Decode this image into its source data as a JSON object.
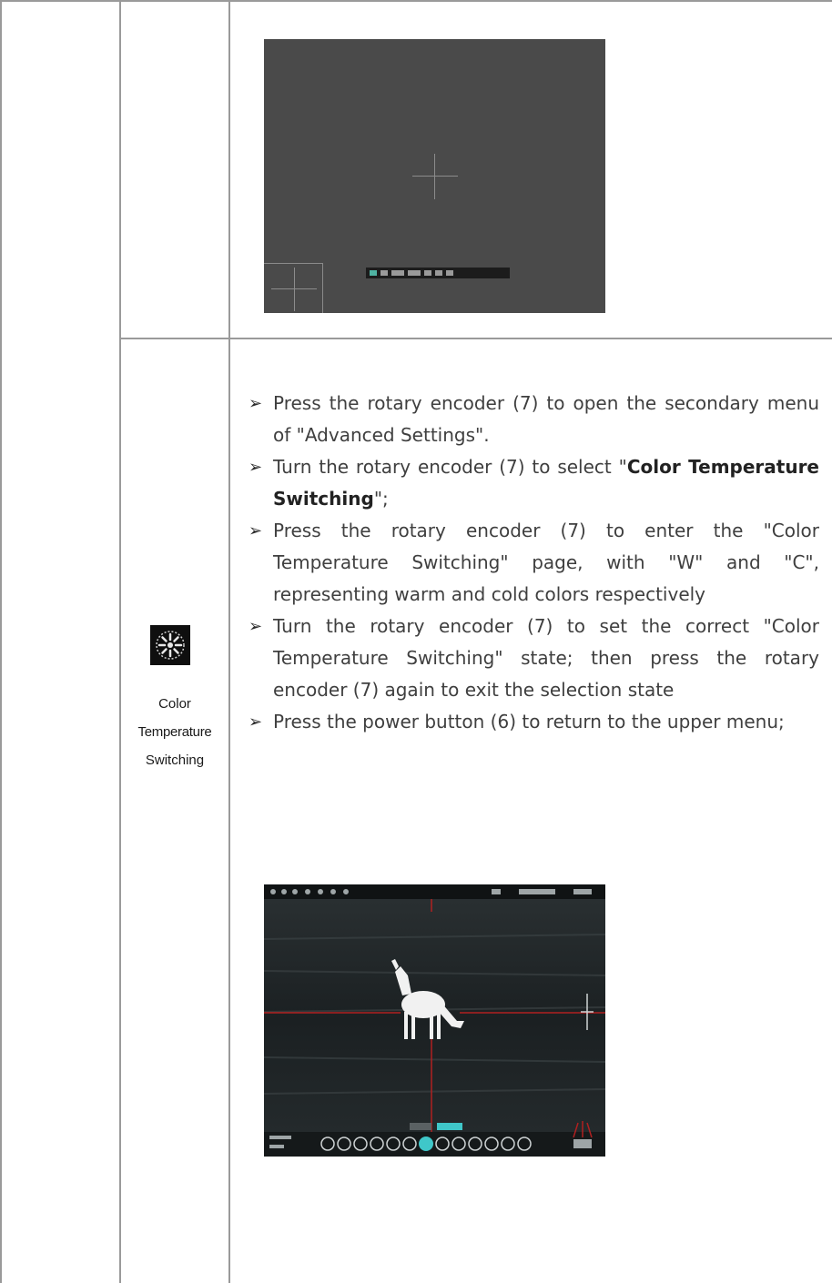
{
  "feature": {
    "icon": "color-temperature-icon",
    "label_lines": [
      "Color",
      "Temperature",
      "Switching"
    ]
  },
  "steps": [
    {
      "pre": "Press the rotary encoder (7) to open the secondary menu of \"Advanced Settings\".",
      "bold": "",
      "post": ""
    },
    {
      "pre": "Turn the rotary encoder (7) to select \"",
      "bold": "Color Temperature Switching",
      "post": "\";"
    },
    {
      "pre": "Press the rotary encoder (7) to enter the \"Color Temperature Switching\" page, with \"W\" and \"C\", representing warm and cold colors respectively",
      "bold": "",
      "post": ""
    },
    {
      "pre": "Turn the rotary encoder (7) to set the correct \"Color Temperature Switching\" state; then press the rotary encoder (7) again to exit the selection state",
      "bold": "",
      "post": ""
    },
    {
      "pre": "Press the power button (6) to return to the upper menu;",
      "bold": "",
      "post": ""
    }
  ],
  "bullet_glyph": "➢",
  "colors": {
    "rule": "#9a9a9a",
    "screen_bg": "#4a4a4a",
    "thermal_bg": "#1d2224",
    "accent_cyan": "#3fc7c9",
    "reticle_red": "#b02020"
  }
}
